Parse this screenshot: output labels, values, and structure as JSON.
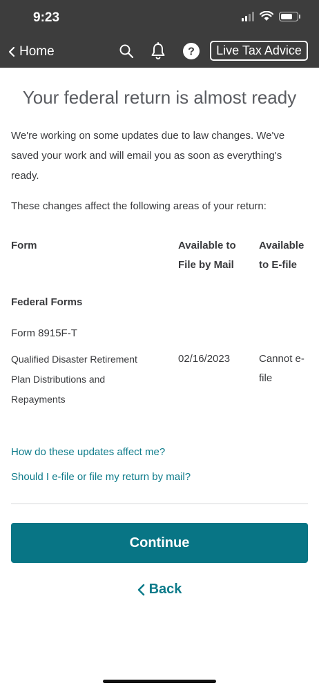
{
  "status": {
    "time": "9:23"
  },
  "header": {
    "back_label": "Home",
    "icons": [
      "search-icon",
      "bell-icon",
      "help-icon"
    ],
    "live_button_label": "Live Tax Advice"
  },
  "main": {
    "title": "Your federal return is almost ready",
    "intro": "We're working on some updates due to law changes. We've saved your work and will email you as soon as everything's ready.",
    "areas_text": "These changes affect the following areas of your return:",
    "table": {
      "headers": {
        "form": "Form",
        "mail": "Available to File by Mail",
        "efile": "Available to E-file"
      },
      "section": "Federal Forms",
      "form_name": "Form 8915F-T",
      "row": {
        "description": "Qualified Disaster Retirement Plan Distributions and Repayments",
        "mail_date": "02/16/2023",
        "efile_status": "Cannot e-file"
      }
    },
    "links": {
      "affect": "How do these updates affect me?",
      "efile_or_mail": "Should I e-file or file my return by mail?"
    },
    "continue_label": "Continue",
    "back_label": "Back"
  },
  "colors": {
    "accent": "#087585",
    "link": "#0d7b8a",
    "header_bg": "#3d3d3d"
  }
}
